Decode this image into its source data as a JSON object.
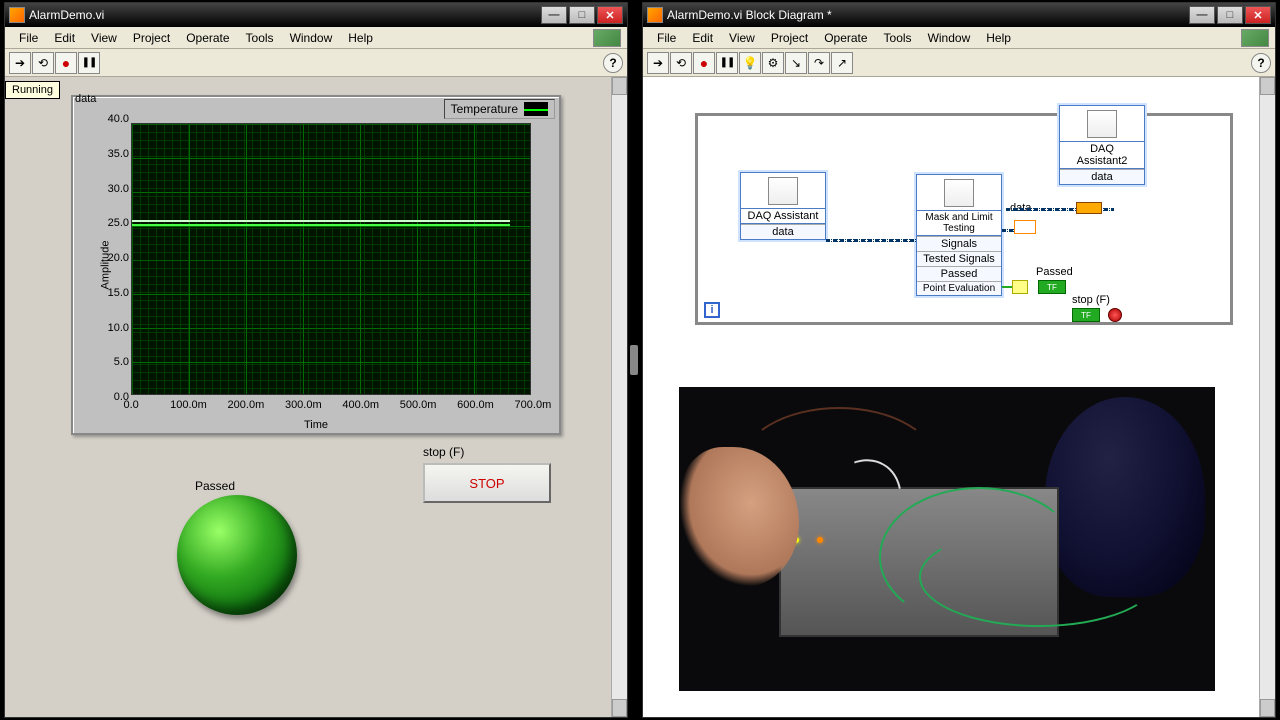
{
  "front_panel": {
    "title": "AlarmDemo.vi",
    "menu": [
      "File",
      "Edit",
      "View",
      "Project",
      "Operate",
      "Tools",
      "Window",
      "Help"
    ],
    "status": "Running",
    "chart": {
      "label": "data",
      "legend": "Temperature"
    },
    "led_label": "Passed",
    "stop_label": "stop (F)",
    "stop_button": "STOP"
  },
  "block_diagram": {
    "title": "AlarmDemo.vi Block Diagram *",
    "menu": [
      "File",
      "Edit",
      "View",
      "Project",
      "Operate",
      "Tools",
      "Window",
      "Help"
    ],
    "nodes": {
      "daq1": {
        "title": "DAQ Assistant",
        "rows": [
          "data"
        ]
      },
      "mask": {
        "title": "Mask and Limit Testing",
        "rows": [
          "Signals",
          "Tested Signals",
          "Passed",
          "Point Evaluation"
        ]
      },
      "daq2": {
        "title": "DAQ Assistant2",
        "rows": [
          "data"
        ]
      }
    },
    "labels": {
      "data_out": "data",
      "passed": "Passed",
      "stop": "stop (F)"
    }
  },
  "chart_data": {
    "type": "line",
    "title": "data",
    "xlabel": "Time",
    "ylabel": "Amplitude",
    "xlim": [
      0.0,
      0.7
    ],
    "ylim": [
      0.0,
      40.0
    ],
    "x_ticks": [
      "0.0",
      "100.0m",
      "200.0m",
      "300.0m",
      "400.0m",
      "500.0m",
      "600.0m",
      "700.0m"
    ],
    "y_ticks": [
      "0.0",
      "5.0",
      "10.0",
      "15.0",
      "20.0",
      "25.0",
      "30.0",
      "35.0",
      "40.0"
    ],
    "series": [
      {
        "name": "Temperature",
        "values": [
          25.5,
          25.5,
          25.5,
          25.5,
          25.5,
          25.5,
          25.5,
          25.5
        ]
      }
    ]
  }
}
